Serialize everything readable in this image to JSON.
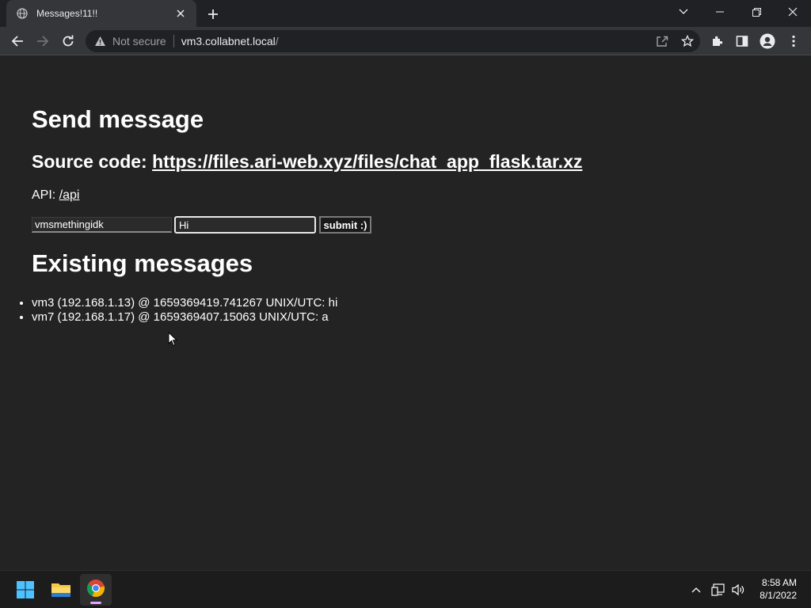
{
  "browser": {
    "tab_title": "Messages!11!!",
    "not_secure_label": "Not secure",
    "url_host": "vm3.collabnet.local",
    "url_path": "/"
  },
  "page": {
    "heading_send": "Send message",
    "source_label": "Source code:",
    "source_link": "https://files.ari-web.xyz/files/chat_app_flask.tar.xz",
    "api_label": "API:",
    "api_link": "/api",
    "form": {
      "name_value": "vmsmethingidk",
      "message_value": "Hi",
      "submit_label": "submit :)"
    },
    "heading_existing": "Existing messages",
    "messages": [
      "vm3 (192.168.1.13) @ 1659369419.741267 UNIX/UTC: hi",
      "vm7 (192.168.1.17) @ 1659369407.15063 UNIX/UTC: a"
    ]
  },
  "taskbar": {
    "time": "8:58 AM",
    "date": "8/1/2022"
  },
  "colors": {
    "page_bg": "#232323",
    "browser_frame": "#202124",
    "toolbar": "#35363a",
    "text": "#ffffff"
  },
  "icons": [
    "globe-icon",
    "close-icon",
    "plus-icon",
    "chevron-down-icon",
    "minimize-icon",
    "restore-icon",
    "back-arrow-icon",
    "forward-arrow-icon",
    "reload-icon",
    "warning-icon",
    "share-icon",
    "star-icon",
    "puzzle-icon",
    "sidepanel-icon",
    "profile-icon",
    "kebab-menu-icon",
    "windows-start-icon",
    "file-explorer-icon",
    "chrome-icon",
    "chevron-up-icon",
    "network-icon",
    "volume-icon"
  ]
}
